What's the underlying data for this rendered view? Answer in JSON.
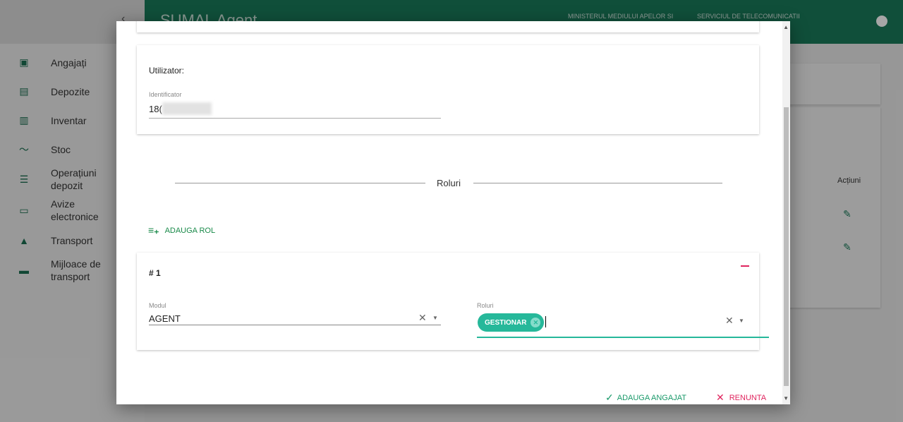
{
  "app": {
    "title": "SUMAL Agent",
    "org1": "MINISTERUL MEDIULUI APELOR SI",
    "org2": "SERVICIUL DE TELECOMUNICATII"
  },
  "sidebar": {
    "items": [
      {
        "label": "Angajați",
        "icon": "briefcase-icon"
      },
      {
        "label": "Depozite",
        "icon": "store-icon"
      },
      {
        "label": "Inventar",
        "icon": "bar-chart-icon"
      },
      {
        "label": "Stoc",
        "icon": "trending-icon"
      },
      {
        "label": "Operațiuni depozit",
        "icon": "list-icon"
      },
      {
        "label": "Avize electronice",
        "icon": "window-icon"
      },
      {
        "label": "Transport",
        "icon": "navigation-icon"
      },
      {
        "label": "Mijloace de transport",
        "icon": "car-icon"
      }
    ]
  },
  "background": {
    "actions_header": "Acțiuni"
  },
  "dialog": {
    "user_title": "Utilizator:",
    "id_label": "Identificator",
    "id_value": "18(          4",
    "roles_heading": "Roluri",
    "add_role": "ADAUGA ROL",
    "role": {
      "number": "# 1",
      "modul_label": "Modul",
      "modul_value": "AGENT",
      "roluri_label": "Roluri",
      "chip": "GESTIONAR"
    },
    "submit": "ADAUGA ANGAJAT",
    "cancel": "RENUNTA"
  },
  "colors": {
    "primary": "#1a7a5a",
    "accent": "#26b89a",
    "danger": "#e0245e"
  }
}
